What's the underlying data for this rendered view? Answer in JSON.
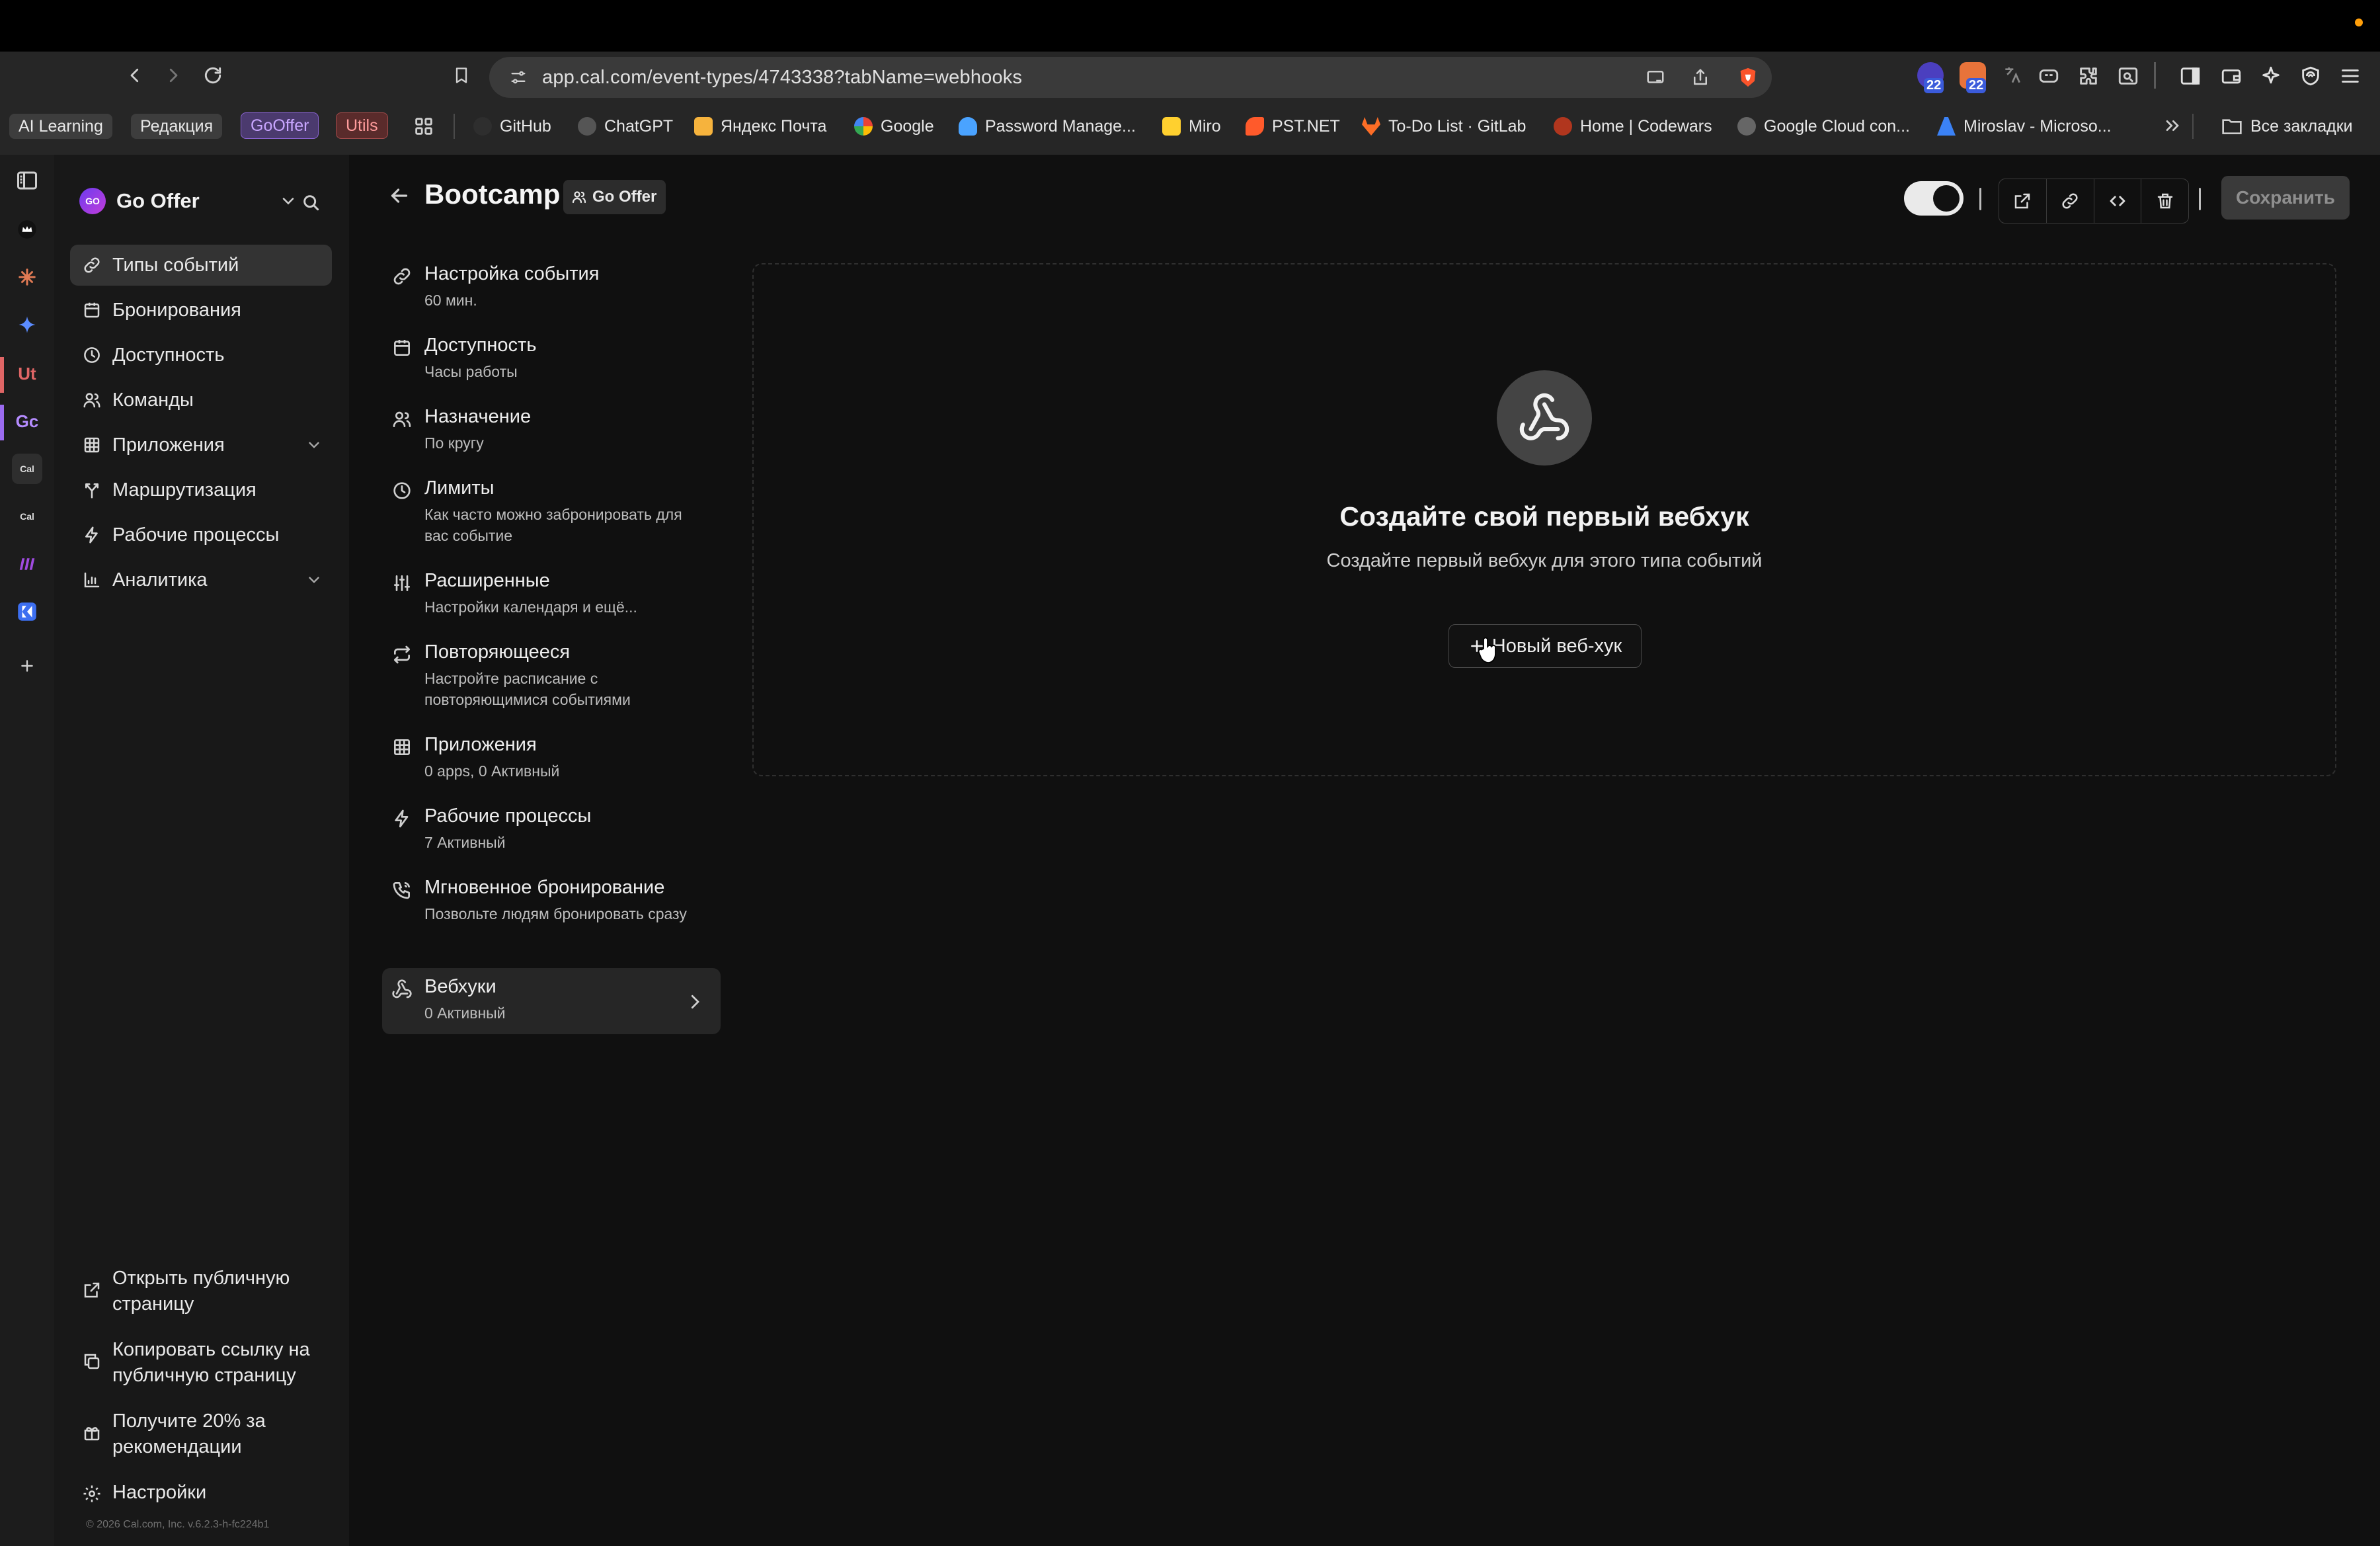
{
  "browser": {
    "url": "app.cal.com/event-types/4743338?tabName=webhooks",
    "bookmarks": {
      "chips": [
        {
          "label": "AI Learning",
          "color": "#3d3d3d",
          "text": "#e8e8e8"
        },
        {
          "label": "Редакция",
          "color": "#3d3d3d",
          "text": "#e8e8e8"
        },
        {
          "label": "GoOffer",
          "color": "#4b3a6e",
          "text": "#c9a6ff"
        },
        {
          "label": "Utils",
          "color": "#5a2b2b",
          "text": "#ff9c9c"
        }
      ],
      "links": [
        {
          "label": "GitHub",
          "fav": "#444444"
        },
        {
          "label": "ChatGPT",
          "fav": "#555555"
        },
        {
          "label": "Яндекс Почта",
          "fav": "#f6b33d"
        },
        {
          "label": "Google",
          "fav": "#ffffff"
        },
        {
          "label": "Password Manage...",
          "fav": "#4aa3ff"
        },
        {
          "label": "Miro",
          "fav": "#ffd02f"
        },
        {
          "label": "PST.NET",
          "fav": "#ff5a2b"
        },
        {
          "label": "To-Do List · GitLab",
          "fav": "#fc6d26"
        },
        {
          "label": "Home | Codewars",
          "fav": "#b1361e"
        },
        {
          "label": "Google Cloud con...",
          "fav": "#666666"
        },
        {
          "label": "Miroslav - Microso...",
          "fav": "#3b82f6"
        }
      ],
      "all_bookmarks": "Все закладки"
    },
    "extension_badges": [
      "22",
      "22"
    ],
    "vertical_tabs": [
      "Ut",
      "Gc",
      "Cal",
      "Cal"
    ]
  },
  "sidebar": {
    "org_initials": "GO",
    "org_name": "Go Offer",
    "nav": [
      {
        "label": "Типы событий",
        "icon": "link-icon",
        "active": true
      },
      {
        "label": "Бронирования",
        "icon": "calendar-icon"
      },
      {
        "label": "Доступность",
        "icon": "clock-icon"
      },
      {
        "label": "Команды",
        "icon": "users-icon"
      },
      {
        "label": "Приложения",
        "icon": "grid-icon",
        "expandable": true
      },
      {
        "label": "Маршрутизация",
        "icon": "split-icon"
      },
      {
        "label": "Рабочие процессы",
        "icon": "zap-icon"
      },
      {
        "label": "Аналитика",
        "icon": "chart-icon",
        "expandable": true
      }
    ],
    "footer": [
      {
        "label": "Открыть публичную страницу",
        "icon": "external-link-icon"
      },
      {
        "label": "Копировать ссылку на публичную страницу",
        "icon": "copy-icon"
      },
      {
        "label": "Получите 20% за рекомендации",
        "icon": "gift-icon"
      },
      {
        "label": "Настройки",
        "icon": "settings-icon"
      }
    ],
    "copyright": "© 2026 Cal.com, Inc. v.6.2.3-h-fc224b1"
  },
  "header": {
    "title": "Bootcamp",
    "team_badge": "Go Offer",
    "save_label": "Сохранить"
  },
  "settings_nav": [
    {
      "title": "Настройка события",
      "sub": "60 мин.",
      "icon": "link-icon"
    },
    {
      "title": "Доступность",
      "sub": "Часы работы",
      "icon": "calendar-icon"
    },
    {
      "title": "Назначение",
      "sub": "По кругу",
      "icon": "users-icon"
    },
    {
      "title": "Лимиты",
      "sub": "Как часто можно забронировать для вас событие",
      "icon": "clock-icon"
    },
    {
      "title": "Расширенные",
      "sub": "Настройки календаря и ещё...",
      "icon": "sliders-icon"
    },
    {
      "title": "Повторяющееся",
      "sub": "Настройте расписание с повторяющимися событиями",
      "icon": "repeat-icon"
    },
    {
      "title": "Приложения",
      "sub": "0 apps, 0 Активный",
      "icon": "grid-icon"
    },
    {
      "title": "Рабочие процессы",
      "sub": "7 Активный",
      "icon": "zap-icon"
    },
    {
      "title": "Мгновенное бронирование",
      "sub": "Позвольте людям бронировать сразу",
      "icon": "phone-icon"
    },
    {
      "title": "Вебхуки",
      "sub": "0 Активный",
      "icon": "webhook-icon",
      "active": true
    }
  ],
  "webhooks": {
    "empty_title": "Создайте свой первый вебхук",
    "empty_subtitle": "Создайте первый вебхук для этого типа событий",
    "new_button": "Новый веб-хук"
  }
}
